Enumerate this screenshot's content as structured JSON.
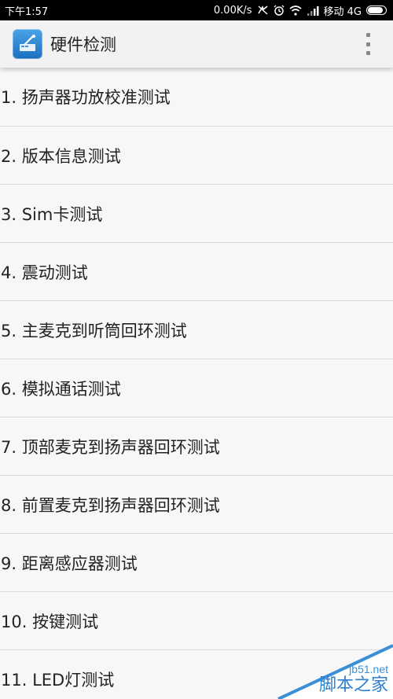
{
  "status_bar": {
    "time": "下午1:57",
    "network_speed": "0.00K/s",
    "carrier": "移动 4G",
    "icons": [
      "nfc-icon",
      "alarm-icon",
      "wifi-icon",
      "signal-icon",
      "battery-icon"
    ],
    "battery_level": 0.85
  },
  "app_bar": {
    "title": "硬件检测",
    "logo_icon": "hardware-test-app-icon",
    "menu_icon": "overflow-menu-icon"
  },
  "tests": [
    "1. 扬声器功放校准测试",
    "2. 版本信息测试",
    "3. Sim卡测试",
    "4. 震动测试",
    "5. 主麦克到听筒回环测试",
    "6. 模拟通话测试",
    "7. 顶部麦克到扬声器回环测试",
    "8. 前置麦克到扬声器回环测试",
    "9. 距离感应器测试",
    "10. 按键测试",
    "11. LED灯测试"
  ],
  "watermark": {
    "site": "jb51.net",
    "name": "脚本之家"
  },
  "colors": {
    "status_bar_bg": "#000000",
    "app_bar_bg": "#f2f2f2",
    "list_bg": "#f7f7f7",
    "divider": "#dcdcdc",
    "watermark_blue": "#2e7fcf"
  }
}
